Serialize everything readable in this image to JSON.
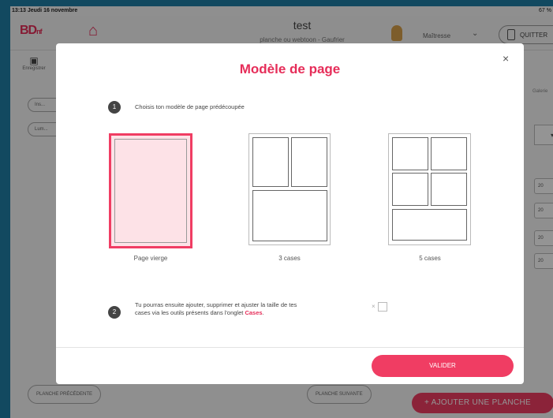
{
  "statusbar": {
    "time": "13:13  Jeudi 16 novembre",
    "battery": "67 %"
  },
  "header": {
    "logo": "BDâ",
    "title": "test",
    "subtitle": "planche ou webtoon - Gaufrier",
    "role": "Maîtresse",
    "quit_label": "QUITTER"
  },
  "background": {
    "save_label": "Enregistrer",
    "right_tab": "Galerie",
    "pill1": "Ins...",
    "pill2": "Lum...",
    "num_values": [
      "20",
      "20",
      "20",
      "20"
    ],
    "prev_plate": "PLANCHE PRÉCÉDENTE",
    "next_plate": "PLANCHE SUIVANTE",
    "add_plate": "+ AJOUTER UNE PLANCHE"
  },
  "modal": {
    "title": "Modèle de page",
    "close": "×",
    "step1": {
      "num": "1",
      "text": "Choisis ton modèle de page prédécoupée"
    },
    "templates": [
      {
        "label": "Page vierge",
        "selected": true
      },
      {
        "label": "3 cases",
        "selected": false
      },
      {
        "label": "5 cases",
        "selected": false
      }
    ],
    "step2": {
      "num": "2",
      "text_line1": "Tu pourras ensuite ajouter, supprimer et ajuster la taille de tes",
      "text_line2_prefix": "cases via les outils présents dans l'onglet ",
      "text_link": "Cases",
      "text_suffix": "."
    },
    "checkbox_prefix": "×",
    "validate_label": "VALIDER"
  },
  "colors": {
    "accent": "#f03d63",
    "background": "#1f7fa6"
  }
}
